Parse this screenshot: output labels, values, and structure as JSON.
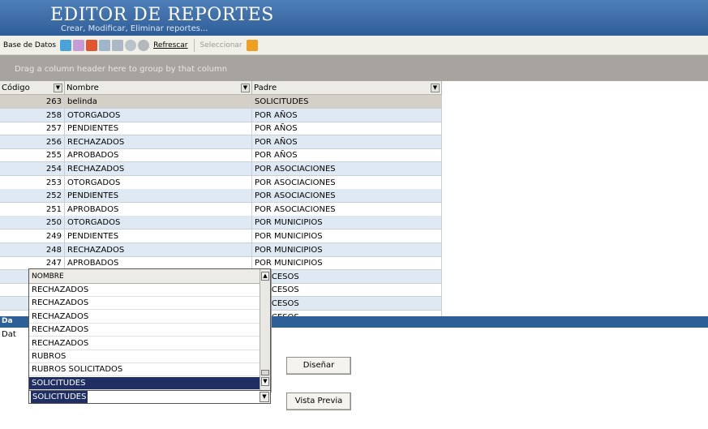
{
  "header": {
    "title": "EDITOR DE REPORTES",
    "subtitle": "Crear, Modificar, Eliminar reportes..."
  },
  "toolbar": {
    "base_datos": "Base de Datos",
    "refrescar": "Refrescar",
    "seleccionar": "Seleccionar",
    "icons": [
      "add-icon",
      "edit-icon",
      "delete-icon",
      "copy-icon",
      "paste-icon",
      "disk-icon",
      "cancel-icon",
      "database-icon"
    ]
  },
  "group_bar": "Drag a column header here to group by that column",
  "grid": {
    "columns": [
      "Código",
      "Nombre",
      "Padre"
    ],
    "rows": [
      {
        "code": "263",
        "name": "belinda",
        "padre": "SOLICITUDES"
      },
      {
        "code": "258",
        "name": "OTORGADOS",
        "padre": "POR AÑOS"
      },
      {
        "code": "257",
        "name": "PENDIENTES",
        "padre": "POR AÑOS"
      },
      {
        "code": "256",
        "name": "RECHAZADOS",
        "padre": "POR AÑOS"
      },
      {
        "code": "255",
        "name": "APROBADOS",
        "padre": "POR AÑOS"
      },
      {
        "code": "254",
        "name": "RECHAZADOS",
        "padre": "POR ASOCIACIONES"
      },
      {
        "code": "253",
        "name": "OTORGADOS",
        "padre": "POR ASOCIACIONES"
      },
      {
        "code": "252",
        "name": "PENDIENTES",
        "padre": "POR ASOCIACIONES"
      },
      {
        "code": "251",
        "name": "APROBADOS",
        "padre": "POR ASOCIACIONES"
      },
      {
        "code": "250",
        "name": "OTORGADOS",
        "padre": "POR MUNICIPIOS"
      },
      {
        "code": "249",
        "name": "PENDIENTES",
        "padre": "POR MUNICIPIOS"
      },
      {
        "code": "248",
        "name": "RECHAZADOS",
        "padre": "POR MUNICIPIOS"
      },
      {
        "code": "247",
        "name": "APROBADOS",
        "padre": "POR MUNICIPIOS"
      },
      {
        "code": "",
        "name": "",
        "padre": "PROCESOS"
      },
      {
        "code": "",
        "name": "",
        "padre": "PROCESOS"
      },
      {
        "code": "",
        "name": "",
        "padre": "PROCESOS"
      },
      {
        "code": "",
        "name": "",
        "padre": "PROCESOS"
      }
    ]
  },
  "panel": {
    "title": "Da",
    "label": "Dat"
  },
  "dropdown": {
    "header": "NOMBRE",
    "items": [
      "RECHAZADOS",
      "RECHAZADOS",
      "RECHAZADOS",
      "RECHAZADOS",
      "RECHAZADOS",
      "RUBROS",
      "RUBROS SOLICITADOS",
      "SOLICITUDES"
    ],
    "selected_value": "SOLICITUDES"
  },
  "buttons": {
    "disenar": "Diseñar",
    "vista_previa": "Vista Previa"
  },
  "colors": {
    "title_bar": "#2f5d97",
    "selection": "#1f2f63",
    "row_alt": "#dfe9f3"
  }
}
